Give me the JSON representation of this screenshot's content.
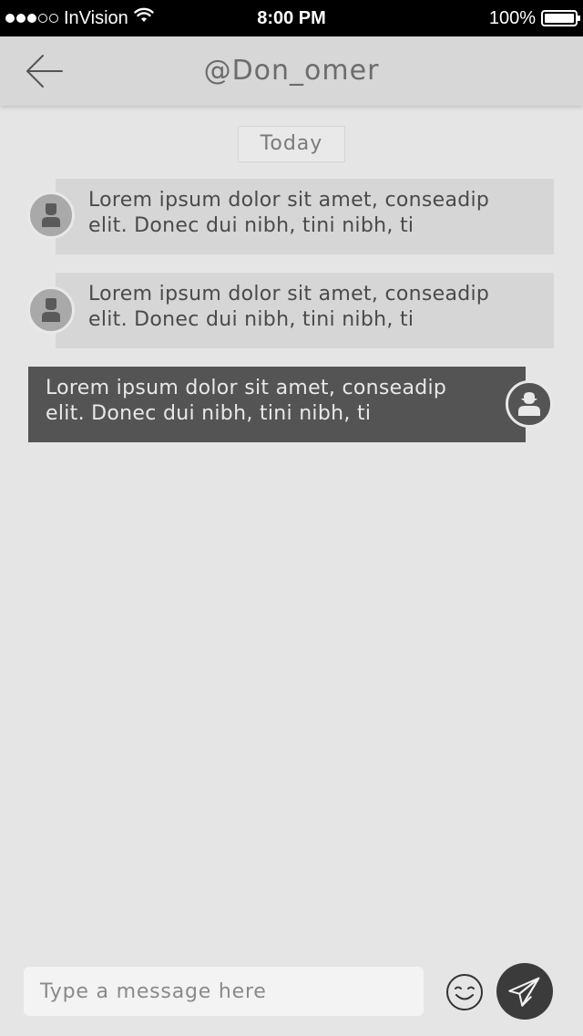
{
  "status_bar": {
    "carrier": "InVision",
    "time": "8:00 PM",
    "battery": "100%",
    "signal_dots": [
      true,
      true,
      true,
      false,
      false
    ]
  },
  "nav": {
    "title": "@Don_omer",
    "back_icon": "back-arrow-icon"
  },
  "date_label": "Today",
  "messages": [
    {
      "direction": "incoming",
      "lines": [
        "Lorem ipsum dolor sit amet, conseadip",
        "elit. Donec dui nibh, tini nibh, ti"
      ]
    },
    {
      "direction": "incoming",
      "lines": [
        "Lorem ipsum dolor sit amet, conseadip",
        "elit. Donec dui nibh, tini nibh, ti"
      ]
    },
    {
      "direction": "outgoing",
      "lines": [
        "Lorem ipsum dolor sit amet, conseadip",
        "elit. Donec dui nibh, tini nibh, ti"
      ]
    }
  ],
  "composer": {
    "placeholder": "Type a message here",
    "value": "",
    "emoji_icon": "smiley-icon",
    "send_icon": "paper-plane-icon"
  },
  "colors": {
    "background": "#e5e5e5",
    "nav_background": "#d7d7d7",
    "incoming_bubble": "#d6d6d6",
    "outgoing_bubble": "#545454",
    "send_button": "#3b3b3b"
  }
}
